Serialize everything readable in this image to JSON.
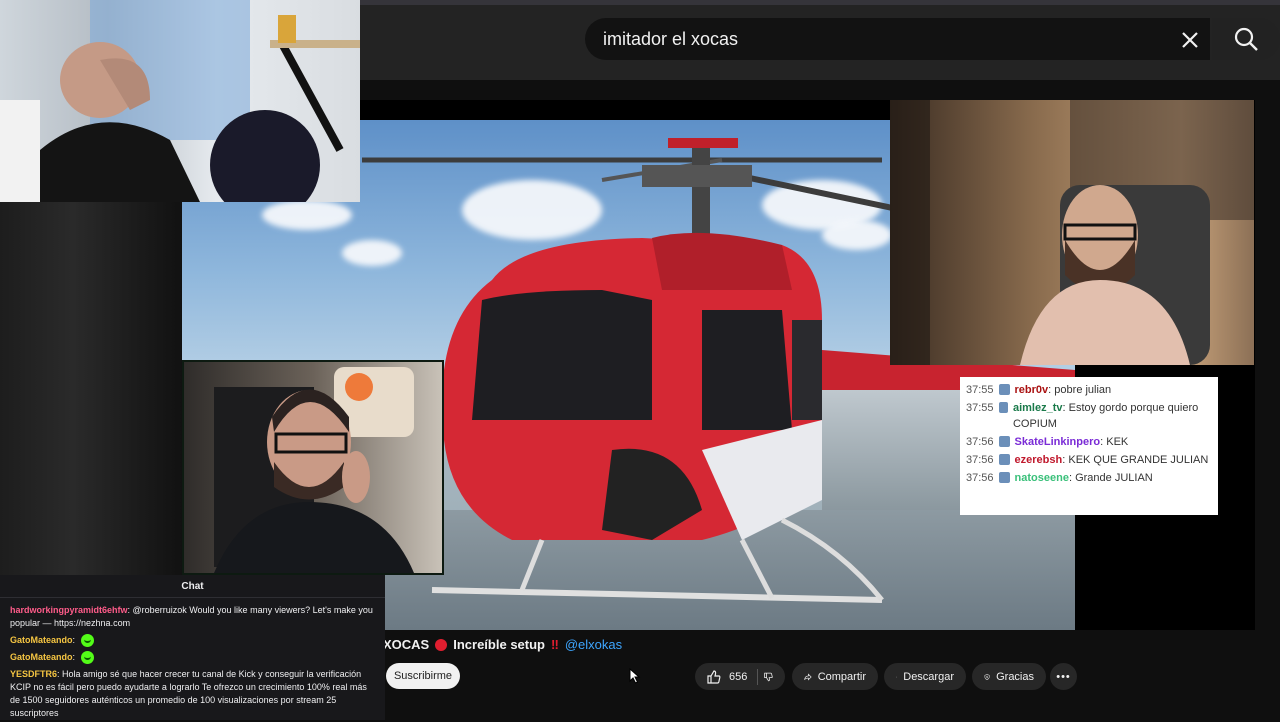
{
  "search": {
    "value": "imitador el xocas"
  },
  "overlay_chat": {
    "rows": [
      {
        "time": "37:55",
        "user": "rebr0v",
        "user_color": "#a11",
        "text": "pobre julian"
      },
      {
        "time": "37:55",
        "user": "aimlez_tv",
        "user_color": "#1a7a4a",
        "text": "Estoy gordo porque quiero COPIUM"
      },
      {
        "time": "37:56",
        "user": "SkateLinkinpero",
        "user_color": "#7a2bd6",
        "text": "KEK"
      },
      {
        "time": "37:56",
        "user": "ezerebsh",
        "user_color": "#c0182c",
        "text": "KEK QUE GRANDE JULIAN"
      },
      {
        "time": "37:56",
        "user": "natoseene",
        "user_color": "#3ac07a",
        "text": "Grande JULIAN"
      }
    ]
  },
  "video": {
    "channel": "XOCAS",
    "title": "Increíble setup",
    "handle": "@elxokas",
    "subscribe_label": "Suscribirme",
    "likes": "656",
    "share_label": "Compartir",
    "download_label": "Descargar",
    "thanks_label": "Gracias"
  },
  "kick_chat": {
    "title": "Chat",
    "messages": [
      {
        "user": "hardworkingpyramidt6ehfw",
        "user_color": "#ff5c8a",
        "text": "@roberruizok Would you like many viewers? Let's make you popular — https://nezhna.com",
        "emote": false
      },
      {
        "user": "GatoMateando",
        "user_color": "#f5c542",
        "text": "",
        "emote": true
      },
      {
        "user": "GatoMateando",
        "user_color": "#f5c542",
        "text": "",
        "emote": true
      },
      {
        "user": "YESDFTR6",
        "user_color": "#f5c542",
        "text": "Hola amigo sé que hacer crecer tu canal de Kick y conseguir la verificación KCIP no es fácil pero puedo ayudarte a lograrlo Te ofrezco un crecimiento 100% real más de 1500 seguidores auténticos un promedio de 100 visualizaciones por stream 25 suscriptores",
        "emote": false
      }
    ]
  }
}
